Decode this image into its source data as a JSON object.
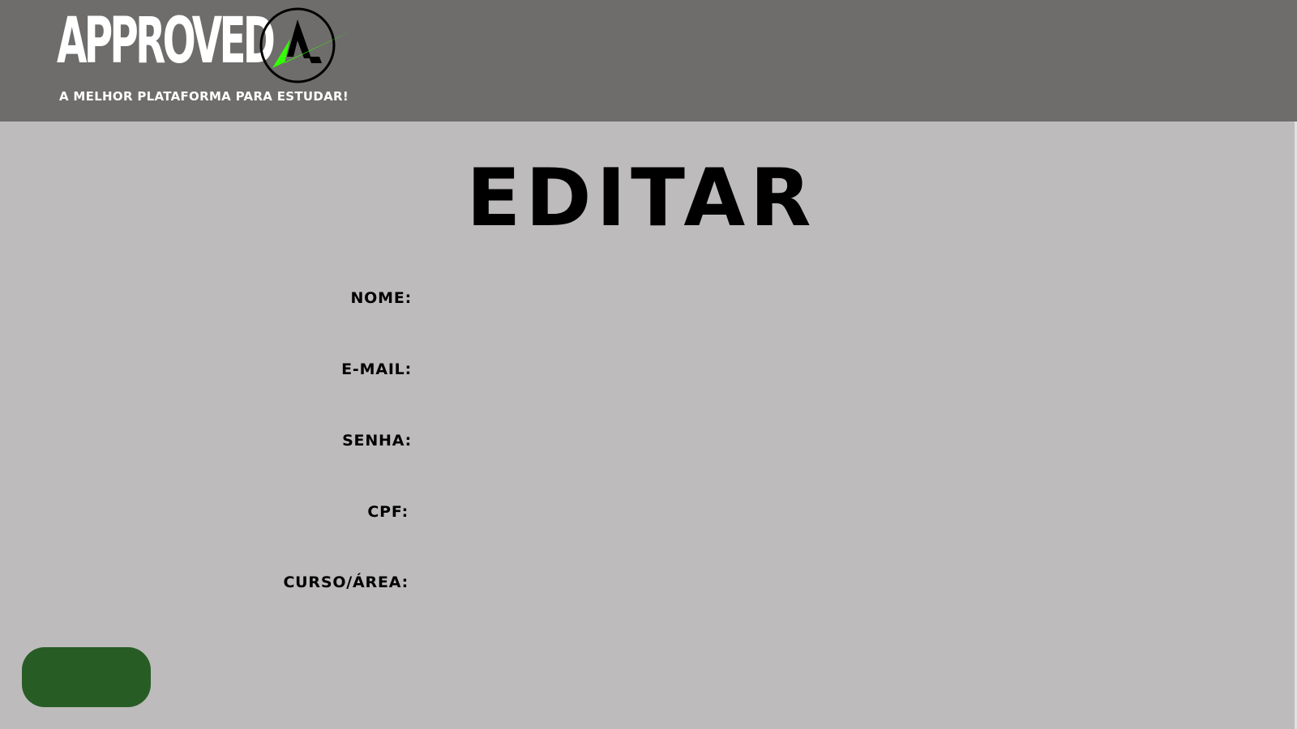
{
  "header": {
    "brand_name": "APPROVED",
    "logo_letter": "A",
    "tagline": "A MELHOR PLATAFORMA PARA ESTUDAR!",
    "logo_check_color": "#33ff00"
  },
  "page": {
    "title": "EDITAR"
  },
  "form": {
    "fields": [
      {
        "label": "NOME:",
        "value": ""
      },
      {
        "label": "E-MAIL:",
        "value": ""
      },
      {
        "label": "SENHA:",
        "value": ""
      },
      {
        "label": "CPF:",
        "value": ""
      },
      {
        "label": "CURSO/ÁREA:",
        "value": ""
      }
    ],
    "submit_label": ""
  },
  "colors": {
    "header_bg": "#6e6d6b",
    "page_bg": "#bdbbbc",
    "button_bg": "#285c25"
  }
}
